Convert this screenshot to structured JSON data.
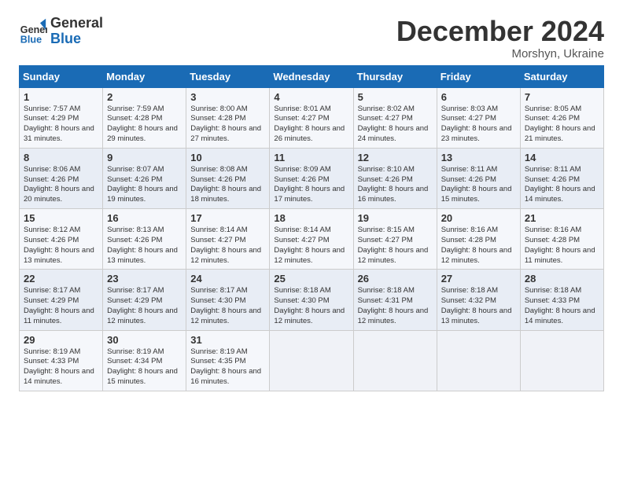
{
  "logo": {
    "general": "General",
    "blue": "Blue"
  },
  "title": "December 2024",
  "subtitle": "Morshyn, Ukraine",
  "days_header": [
    "Sunday",
    "Monday",
    "Tuesday",
    "Wednesday",
    "Thursday",
    "Friday",
    "Saturday"
  ],
  "weeks": [
    [
      {
        "day": "1",
        "sunrise": "7:57 AM",
        "sunset": "4:29 PM",
        "daylight": "8 hours and 31 minutes."
      },
      {
        "day": "2",
        "sunrise": "7:59 AM",
        "sunset": "4:28 PM",
        "daylight": "8 hours and 29 minutes."
      },
      {
        "day": "3",
        "sunrise": "8:00 AM",
        "sunset": "4:28 PM",
        "daylight": "8 hours and 27 minutes."
      },
      {
        "day": "4",
        "sunrise": "8:01 AM",
        "sunset": "4:27 PM",
        "daylight": "8 hours and 26 minutes."
      },
      {
        "day": "5",
        "sunrise": "8:02 AM",
        "sunset": "4:27 PM",
        "daylight": "8 hours and 24 minutes."
      },
      {
        "day": "6",
        "sunrise": "8:03 AM",
        "sunset": "4:27 PM",
        "daylight": "8 hours and 23 minutes."
      },
      {
        "day": "7",
        "sunrise": "8:05 AM",
        "sunset": "4:26 PM",
        "daylight": "8 hours and 21 minutes."
      }
    ],
    [
      {
        "day": "8",
        "sunrise": "8:06 AM",
        "sunset": "4:26 PM",
        "daylight": "8 hours and 20 minutes."
      },
      {
        "day": "9",
        "sunrise": "8:07 AM",
        "sunset": "4:26 PM",
        "daylight": "8 hours and 19 minutes."
      },
      {
        "day": "10",
        "sunrise": "8:08 AM",
        "sunset": "4:26 PM",
        "daylight": "8 hours and 18 minutes."
      },
      {
        "day": "11",
        "sunrise": "8:09 AM",
        "sunset": "4:26 PM",
        "daylight": "8 hours and 17 minutes."
      },
      {
        "day": "12",
        "sunrise": "8:10 AM",
        "sunset": "4:26 PM",
        "daylight": "8 hours and 16 minutes."
      },
      {
        "day": "13",
        "sunrise": "8:11 AM",
        "sunset": "4:26 PM",
        "daylight": "8 hours and 15 minutes."
      },
      {
        "day": "14",
        "sunrise": "8:11 AM",
        "sunset": "4:26 PM",
        "daylight": "8 hours and 14 minutes."
      }
    ],
    [
      {
        "day": "15",
        "sunrise": "8:12 AM",
        "sunset": "4:26 PM",
        "daylight": "8 hours and 13 minutes."
      },
      {
        "day": "16",
        "sunrise": "8:13 AM",
        "sunset": "4:26 PM",
        "daylight": "8 hours and 13 minutes."
      },
      {
        "day": "17",
        "sunrise": "8:14 AM",
        "sunset": "4:27 PM",
        "daylight": "8 hours and 12 minutes."
      },
      {
        "day": "18",
        "sunrise": "8:14 AM",
        "sunset": "4:27 PM",
        "daylight": "8 hours and 12 minutes."
      },
      {
        "day": "19",
        "sunrise": "8:15 AM",
        "sunset": "4:27 PM",
        "daylight": "8 hours and 12 minutes."
      },
      {
        "day": "20",
        "sunrise": "8:16 AM",
        "sunset": "4:28 PM",
        "daylight": "8 hours and 12 minutes."
      },
      {
        "day": "21",
        "sunrise": "8:16 AM",
        "sunset": "4:28 PM",
        "daylight": "8 hours and 11 minutes."
      }
    ],
    [
      {
        "day": "22",
        "sunrise": "8:17 AM",
        "sunset": "4:29 PM",
        "daylight": "8 hours and 11 minutes."
      },
      {
        "day": "23",
        "sunrise": "8:17 AM",
        "sunset": "4:29 PM",
        "daylight": "8 hours and 12 minutes."
      },
      {
        "day": "24",
        "sunrise": "8:17 AM",
        "sunset": "4:30 PM",
        "daylight": "8 hours and 12 minutes."
      },
      {
        "day": "25",
        "sunrise": "8:18 AM",
        "sunset": "4:30 PM",
        "daylight": "8 hours and 12 minutes."
      },
      {
        "day": "26",
        "sunrise": "8:18 AM",
        "sunset": "4:31 PM",
        "daylight": "8 hours and 12 minutes."
      },
      {
        "day": "27",
        "sunrise": "8:18 AM",
        "sunset": "4:32 PM",
        "daylight": "8 hours and 13 minutes."
      },
      {
        "day": "28",
        "sunrise": "8:18 AM",
        "sunset": "4:33 PM",
        "daylight": "8 hours and 14 minutes."
      }
    ],
    [
      {
        "day": "29",
        "sunrise": "8:19 AM",
        "sunset": "4:33 PM",
        "daylight": "8 hours and 14 minutes."
      },
      {
        "day": "30",
        "sunrise": "8:19 AM",
        "sunset": "4:34 PM",
        "daylight": "8 hours and 15 minutes."
      },
      {
        "day": "31",
        "sunrise": "8:19 AM",
        "sunset": "4:35 PM",
        "daylight": "8 hours and 16 minutes."
      },
      null,
      null,
      null,
      null
    ]
  ],
  "labels": {
    "sunrise": "Sunrise: ",
    "sunset": "Sunset: ",
    "daylight": "Daylight: "
  }
}
